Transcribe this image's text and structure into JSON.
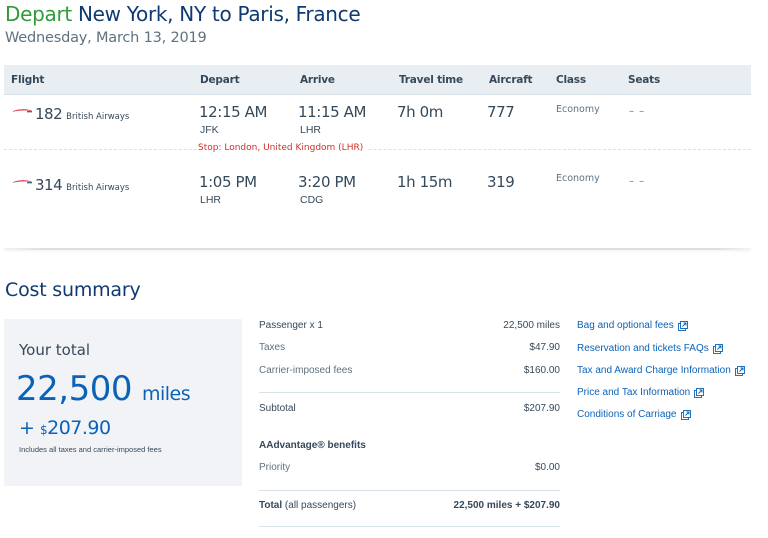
{
  "header": {
    "depart_label": "Depart",
    "route": "New York, NY to Paris, France",
    "date": "Wednesday, March 13, 2019"
  },
  "table": {
    "columns": [
      "Flight",
      "Depart",
      "Arrive",
      "Travel time",
      "Aircraft",
      "Class",
      "Seats"
    ],
    "rows": [
      {
        "flight_number": "182",
        "airline": "British Airways",
        "airline_icon": "british-airways-logo",
        "depart_time": "12:15 AM",
        "depart_code": "JFK",
        "arrive_time": "11:15 AM",
        "arrive_code": "LHR",
        "travel_time": "7h 0m",
        "aircraft": "777",
        "class": "Economy",
        "seats": "– –"
      },
      {
        "flight_number": "314",
        "airline": "British Airways",
        "airline_icon": "british-airways-logo",
        "depart_time": "1:05 PM",
        "depart_code": "LHR",
        "arrive_time": "3:20 PM",
        "arrive_code": "CDG",
        "travel_time": "1h 15m",
        "aircraft": "319",
        "class": "Economy",
        "seats": "– –"
      }
    ],
    "stop_text": "Stop: London, United Kingdom (LHR)"
  },
  "cost_summary": {
    "title": "Cost summary",
    "total_box": {
      "label": "Your total",
      "miles": "22,500",
      "miles_unit": "miles",
      "plus": "+",
      "currency_symbol": "$",
      "amount": "207.90",
      "note": "Includes all taxes and carrier-imposed fees"
    },
    "lines": {
      "passenger": {
        "label": "Passenger x 1",
        "value": "22,500 miles"
      },
      "taxes": {
        "label": "Taxes",
        "value": "$47.90"
      },
      "carrier_fees": {
        "label": "Carrier-imposed fees",
        "value": "$160.00"
      },
      "subtotal": {
        "label": "Subtotal",
        "value": "$207.90"
      },
      "benefits_heading": "AAdvantage® benefits",
      "priority": {
        "label": "Priority",
        "value": "$0.00"
      },
      "total": {
        "label_bold": "Total",
        "label_rest": " (all passengers)",
        "value": "22,500 miles + $207.90"
      }
    },
    "links": [
      {
        "label": "Bag and optional fees",
        "icon": "external-link-icon"
      },
      {
        "label": "Reservation and tickets FAQs",
        "icon": "external-link-icon"
      },
      {
        "label": "Tax and Award Charge Information",
        "icon": "external-link-icon"
      },
      {
        "label": "Price and Tax Information",
        "icon": "external-link-icon"
      },
      {
        "label": "Conditions of Carriage",
        "icon": "external-link-icon"
      }
    ]
  },
  "colors": {
    "depart_green": "#2f9b39",
    "heading_navy": "#0f3a71",
    "link_blue": "#0b63b8",
    "stop_red": "#d0302a",
    "table_header_bg": "#e8eef1",
    "total_box_bg": "#f2f3f6"
  }
}
